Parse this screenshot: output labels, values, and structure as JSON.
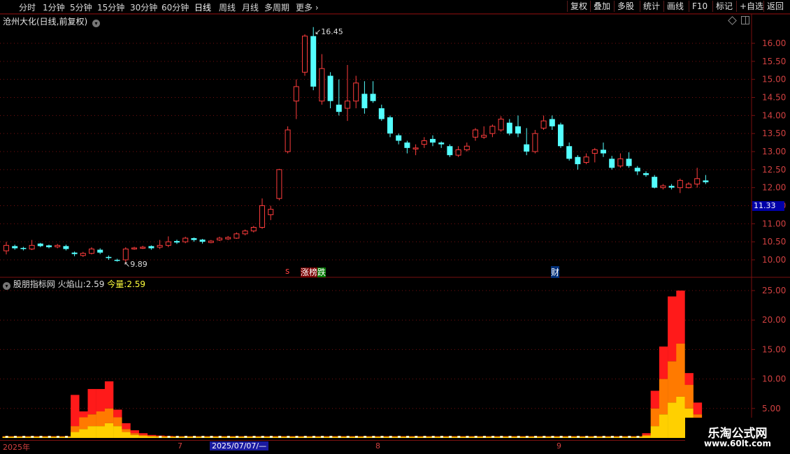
{
  "toolbar": {
    "periods": [
      "分时",
      "1分钟",
      "5分钟",
      "15分钟",
      "30分钟",
      "60分钟",
      "日线",
      "周线",
      "月线",
      "多周期",
      "更多"
    ],
    "active_period": "日线",
    "right_buttons": [
      "复权",
      "叠加",
      "多股",
      "统计",
      "画线",
      "F10",
      "标记",
      "+自选",
      "返回"
    ]
  },
  "chart_header": {
    "stock_title": "沧州大化(日线,前复权)"
  },
  "price_axis": {
    "ticks": [
      "16.00",
      "15.50",
      "15.00",
      "14.50",
      "14.00",
      "13.50",
      "13.00",
      "12.50",
      "12.00",
      "11.50",
      "11.00",
      "10.50",
      "10.00"
    ],
    "current_price": "11.33"
  },
  "annotations": {
    "high_label": "16.45",
    "low_label": "9.89",
    "event_zhangting": "涨",
    "event_bang": "榜",
    "event_die": "跌",
    "event_cai": "财",
    "event_s": "s"
  },
  "indicator": {
    "prefix": "股朋指标网",
    "huoyanshan_label": "火焰山:",
    "huoyanshan_value": "2.59",
    "jinliang_label": "今量:",
    "jinliang_value": "2.59",
    "ticks": [
      "25.00",
      "20.00",
      "15.00",
      "10.00",
      "5.00"
    ]
  },
  "date_axis": {
    "labels": [
      "2025年",
      "7",
      "2025/07/07/—",
      "8",
      "9"
    ]
  },
  "watermark": {
    "line1": "乐淘公式网",
    "line2": "www.60lt.com"
  },
  "colors": {
    "up": "#ff3c3c",
    "down": "#54ffff",
    "grid": "#7a1010",
    "flame_red": "#ff1a1a",
    "flame_orange": "#ff7a00",
    "flame_yellow": "#ffd000"
  },
  "chart_data": {
    "type": "candlestick",
    "price_ylim": [
      9.7,
      16.7
    ],
    "indicator_ylim": [
      0,
      26
    ],
    "candles": [
      [
        10.25,
        10.4,
        10.5,
        10.15
      ],
      [
        10.38,
        10.32,
        10.42,
        10.28
      ],
      [
        10.33,
        10.3,
        10.36,
        10.26
      ],
      [
        10.3,
        10.4,
        10.55,
        10.27
      ],
      [
        10.45,
        10.38,
        10.47,
        10.35
      ],
      [
        10.4,
        10.35,
        10.42,
        10.32
      ],
      [
        10.36,
        10.4,
        10.44,
        10.32
      ],
      [
        10.38,
        10.3,
        10.42,
        10.26
      ],
      [
        10.2,
        10.16,
        10.23,
        10.1
      ],
      [
        10.12,
        10.18,
        10.22,
        10.08
      ],
      [
        10.18,
        10.3,
        10.35,
        10.15
      ],
      [
        10.28,
        10.2,
        10.32,
        10.16
      ],
      [
        10.08,
        10.05,
        10.12,
        10.0
      ],
      [
        10.0,
        9.98,
        10.03,
        9.95
      ],
      [
        10.0,
        10.3,
        10.35,
        9.89
      ],
      [
        10.3,
        10.33,
        10.36,
        10.28
      ],
      [
        10.33,
        10.35,
        10.39,
        10.3
      ],
      [
        10.38,
        10.32,
        10.4,
        10.28
      ],
      [
        10.35,
        10.4,
        10.55,
        10.3
      ],
      [
        10.4,
        10.5,
        10.65,
        10.35
      ],
      [
        10.52,
        10.48,
        10.56,
        10.44
      ],
      [
        10.5,
        10.6,
        10.64,
        10.46
      ],
      [
        10.6,
        10.55,
        10.62,
        10.5
      ],
      [
        10.56,
        10.5,
        10.58,
        10.45
      ],
      [
        10.48,
        10.52,
        10.55,
        10.46
      ],
      [
        10.55,
        10.6,
        10.64,
        10.52
      ],
      [
        10.58,
        10.62,
        10.66,
        10.55
      ],
      [
        10.6,
        10.72,
        10.76,
        10.58
      ],
      [
        10.72,
        10.8,
        10.84,
        10.68
      ],
      [
        10.8,
        10.9,
        10.94,
        10.76
      ],
      [
        10.9,
        11.5,
        11.7,
        10.86
      ],
      [
        11.25,
        11.4,
        11.5,
        11.1
      ],
      [
        11.7,
        12.5,
        12.52,
        11.65
      ],
      [
        13.0,
        13.6,
        13.7,
        12.95
      ],
      [
        14.4,
        14.8,
        15.0,
        13.9
      ],
      [
        15.2,
        16.2,
        16.25,
        15.1
      ],
      [
        16.2,
        14.8,
        16.45,
        14.7
      ],
      [
        14.4,
        15.3,
        15.7,
        14.3
      ],
      [
        15.1,
        14.4,
        15.2,
        14.2
      ],
      [
        14.3,
        14.1,
        15.0,
        14.0
      ],
      [
        14.2,
        14.4,
        15.4,
        13.85
      ],
      [
        14.4,
        14.9,
        15.1,
        14.2
      ],
      [
        14.6,
        14.2,
        14.95,
        14.05
      ],
      [
        14.6,
        14.4,
        14.95,
        14.35
      ],
      [
        14.2,
        13.9,
        14.3,
        13.85
      ],
      [
        13.95,
        13.5,
        14.0,
        13.4
      ],
      [
        13.45,
        13.3,
        13.5,
        13.2
      ],
      [
        13.25,
        13.1,
        13.3,
        12.95
      ],
      [
        13.1,
        13.1,
        13.2,
        12.9
      ],
      [
        13.2,
        13.3,
        13.4,
        13.1
      ],
      [
        13.35,
        13.25,
        13.45,
        13.15
      ],
      [
        13.25,
        13.2,
        13.28,
        13.1
      ],
      [
        13.15,
        12.9,
        13.2,
        12.85
      ],
      [
        12.9,
        13.05,
        13.15,
        12.85
      ],
      [
        13.05,
        13.15,
        13.25,
        13.0
      ],
      [
        13.4,
        13.6,
        13.65,
        13.3
      ],
      [
        13.4,
        13.45,
        13.7,
        13.35
      ],
      [
        13.5,
        13.7,
        13.75,
        13.4
      ],
      [
        13.6,
        13.9,
        13.98,
        13.55
      ],
      [
        13.8,
        13.5,
        13.9,
        13.45
      ],
      [
        13.7,
        13.5,
        14.0,
        13.4
      ],
      [
        13.2,
        13.0,
        13.65,
        12.9
      ],
      [
        13.0,
        13.5,
        13.6,
        12.95
      ],
      [
        13.65,
        13.85,
        14.0,
        13.6
      ],
      [
        13.9,
        13.7,
        14.0,
        13.6
      ],
      [
        13.75,
        13.15,
        13.8,
        13.1
      ],
      [
        13.15,
        12.8,
        13.25,
        12.75
      ],
      [
        12.85,
        12.65,
        12.9,
        12.5
      ],
      [
        12.7,
        12.85,
        12.95,
        12.65
      ],
      [
        12.95,
        13.05,
        13.1,
        12.7
      ],
      [
        13.05,
        12.95,
        13.25,
        12.85
      ],
      [
        12.8,
        12.55,
        12.88,
        12.5
      ],
      [
        12.6,
        12.8,
        12.95,
        12.55
      ],
      [
        12.8,
        12.6,
        12.98,
        12.55
      ],
      [
        12.55,
        12.45,
        12.6,
        12.35
      ],
      [
        12.4,
        12.35,
        12.45,
        12.3
      ],
      [
        12.3,
        12.0,
        12.35,
        11.98
      ],
      [
        12.0,
        12.05,
        12.1,
        11.95
      ],
      [
        12.05,
        12.0,
        12.1,
        11.95
      ],
      [
        12.0,
        12.2,
        12.25,
        11.85
      ],
      [
        12.0,
        12.1,
        12.15,
        11.98
      ],
      [
        12.1,
        12.25,
        12.55,
        12.0
      ],
      [
        12.2,
        12.15,
        12.35,
        12.1
      ]
    ],
    "flame": [
      [
        0.2,
        0.25,
        0.3
      ],
      [
        0.2,
        0.25,
        0.3
      ],
      [
        0.2,
        0.25,
        0.3
      ],
      [
        0.2,
        0.25,
        0.3
      ],
      [
        0.2,
        0.25,
        0.3
      ],
      [
        0.2,
        0.25,
        0.3
      ],
      [
        0.2,
        0.25,
        0.3
      ],
      [
        0.2,
        0.25,
        0.3
      ],
      [
        1,
        2,
        7.3
      ],
      [
        1.5,
        3.5,
        4.5
      ],
      [
        2,
        4,
        8.3
      ],
      [
        2,
        4.5,
        8.3
      ],
      [
        2.5,
        5,
        9.6
      ],
      [
        2,
        3.5,
        4.8
      ],
      [
        1,
        1.5,
        2.5
      ],
      [
        0.5,
        0.8,
        1.3
      ],
      [
        0.3,
        0.5,
        0.8
      ],
      [
        0.25,
        0.35,
        0.5
      ],
      [
        0.2,
        0.3,
        0.4
      ],
      [
        0.2,
        0.25,
        0.35
      ],
      [
        0.2,
        0.25,
        0.3
      ],
      [
        0.2,
        0.25,
        0.3
      ],
      [
        0.2,
        0.25,
        0.3
      ],
      [
        0.2,
        0.25,
        0.3
      ],
      [
        0.2,
        0.25,
        0.3
      ],
      [
        0.2,
        0.25,
        0.3
      ],
      [
        0.2,
        0.25,
        0.3
      ],
      [
        0.2,
        0.25,
        0.3
      ],
      [
        0.2,
        0.25,
        0.3
      ],
      [
        0.2,
        0.25,
        0.3
      ],
      [
        0.2,
        0.25,
        0.3
      ],
      [
        0.2,
        0.25,
        0.3
      ],
      [
        0.2,
        0.25,
        0.3
      ],
      [
        0.2,
        0.25,
        0.3
      ],
      [
        0.2,
        0.25,
        0.3
      ],
      [
        0.2,
        0.25,
        0.3
      ],
      [
        0.2,
        0.25,
        0.3
      ],
      [
        0.2,
        0.25,
        0.3
      ],
      [
        0.2,
        0.25,
        0.3
      ],
      [
        0.2,
        0.25,
        0.3
      ],
      [
        0.2,
        0.25,
        0.3
      ],
      [
        0.2,
        0.25,
        0.3
      ],
      [
        0.2,
        0.25,
        0.3
      ],
      [
        0.2,
        0.25,
        0.3
      ],
      [
        0.2,
        0.25,
        0.3
      ],
      [
        0.2,
        0.25,
        0.3
      ],
      [
        0.2,
        0.25,
        0.3
      ],
      [
        0.2,
        0.25,
        0.3
      ],
      [
        0.2,
        0.25,
        0.3
      ],
      [
        0.2,
        0.25,
        0.3
      ],
      [
        0.2,
        0.25,
        0.3
      ],
      [
        0.2,
        0.25,
        0.3
      ],
      [
        0.2,
        0.25,
        0.3
      ],
      [
        0.2,
        0.25,
        0.3
      ],
      [
        0.2,
        0.25,
        0.3
      ],
      [
        0.2,
        0.25,
        0.3
      ],
      [
        0.2,
        0.25,
        0.3
      ],
      [
        0.2,
        0.25,
        0.3
      ],
      [
        0.2,
        0.25,
        0.3
      ],
      [
        0.2,
        0.25,
        0.3
      ],
      [
        0.2,
        0.25,
        0.3
      ],
      [
        0.2,
        0.25,
        0.3
      ],
      [
        0.2,
        0.25,
        0.3
      ],
      [
        0.2,
        0.25,
        0.3
      ],
      [
        0.2,
        0.25,
        0.3
      ],
      [
        0.2,
        0.25,
        0.3
      ],
      [
        0.2,
        0.25,
        0.3
      ],
      [
        0.2,
        0.25,
        0.3
      ],
      [
        0.2,
        0.25,
        0.3
      ],
      [
        0.2,
        0.25,
        0.3
      ],
      [
        0.2,
        0.25,
        0.3
      ],
      [
        0.2,
        0.25,
        0.3
      ],
      [
        0.2,
        0.25,
        0.3
      ],
      [
        0.2,
        0.25,
        0.3
      ],
      [
        0.2,
        0.25,
        0.3
      ],
      [
        0.3,
        0.5,
        0.8
      ],
      [
        2,
        5,
        8
      ],
      [
        4,
        10,
        15.5
      ],
      [
        6,
        13,
        24
      ],
      [
        7,
        16,
        25
      ],
      [
        5,
        9,
        11
      ],
      [
        2,
        4,
        6
      ],
      [
        1,
        2,
        3
      ]
    ]
  }
}
